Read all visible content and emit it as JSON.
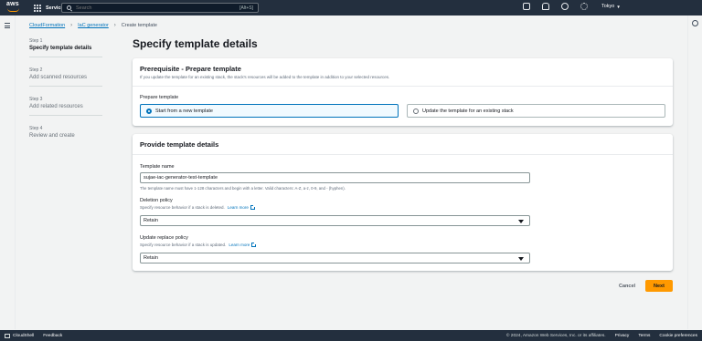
{
  "topnav": {
    "logo": "aws",
    "services_label": "Services",
    "search_placeholder": "Search",
    "search_shortcut": "[Alt+S]",
    "region": "Tokyo",
    "icons": [
      "cloudshell-icon",
      "bell-icon",
      "help-icon",
      "gear-icon"
    ]
  },
  "breadcrumb": {
    "items": [
      "CloudFormation",
      "IaC generator"
    ],
    "current": "Create template"
  },
  "steps": [
    {
      "num": "Step 1",
      "label": "Specify template details",
      "active": true
    },
    {
      "num": "Step 2",
      "label": "Add scanned resources",
      "active": false
    },
    {
      "num": "Step 3",
      "label": "Add related resources",
      "active": false
    },
    {
      "num": "Step 4",
      "label": "Review and create",
      "active": false
    }
  ],
  "page_title": "Specify template details",
  "prereq": {
    "title": "Prerequisite - Prepare template",
    "subtitle": "If you update the template for an existing stack, the stack's resources will be added to the template in addition to your selected resources.",
    "field_label": "Prepare template",
    "options": [
      {
        "label": "Start from a new template",
        "selected": true
      },
      {
        "label": "Update the template for an existing stack",
        "selected": false
      }
    ]
  },
  "details": {
    "title": "Provide template details",
    "template_name_label": "Template name",
    "template_name_value": "sujae-iac-generator-test-template",
    "template_name_hint": "The template name must have 1-128 characters and begin with a letter. Valid characters: A-Z, a-z, 0-9, and - (hyphen).",
    "deletion_label": "Deletion policy",
    "deletion_desc": "Specify resource behavior if a stack is deleted.",
    "learn_more": "Learn more",
    "deletion_value": "Retain",
    "update_label": "Update replace policy",
    "update_desc": "Specify resource behavior if a stack is updated.",
    "update_value": "Retain"
  },
  "actions": {
    "cancel": "Cancel",
    "next": "Next"
  },
  "footer": {
    "cloudshell": "CloudShell",
    "feedback": "Feedback",
    "copyright": "© 2024, Amazon Web Services, Inc. or its affiliates.",
    "links": [
      "Privacy",
      "Terms",
      "Cookie preferences"
    ]
  },
  "colors": {
    "nav_bg": "#232f3e",
    "accent": "#ff9900",
    "link": "#0073bb",
    "page_bg": "#f2f3f3"
  }
}
